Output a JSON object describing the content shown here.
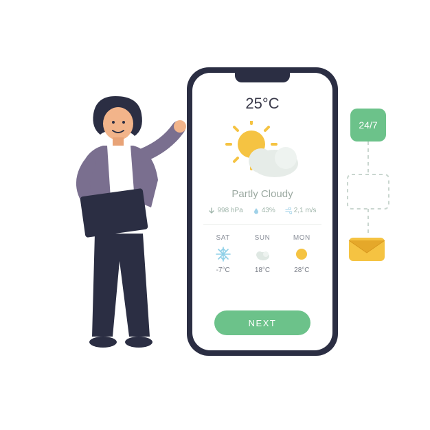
{
  "weather": {
    "temperature": "25°C",
    "condition": "Partly Cloudy",
    "metrics": {
      "pressure_icon": "arrow-down",
      "pressure": "998 hPa",
      "humidity_icon": "droplet",
      "humidity": "43%",
      "wind_icon": "wind",
      "wind": "2,1 m/s"
    },
    "forecast": [
      {
        "day": "SAT",
        "icon": "snow",
        "temp": "-7°C"
      },
      {
        "day": "SUN",
        "icon": "cloud",
        "temp": "18°C"
      },
      {
        "day": "MON",
        "icon": "sun",
        "temp": "28°C"
      }
    ],
    "next_label": "NEXT"
  },
  "badges": {
    "availability": "24/7"
  },
  "colors": {
    "accent": "#6cc28a",
    "sun": "#f5c342",
    "cloud": "#dfe8e3",
    "snow": "#8fd0e8",
    "mail_body": "#f5c342",
    "mail_flap": "#e5a82a",
    "text_muted": "#9aa8a0"
  }
}
